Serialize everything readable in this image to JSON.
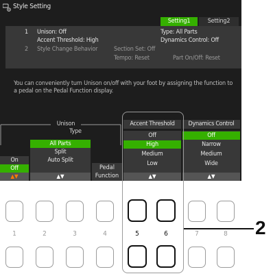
{
  "title": "Style Setting",
  "tabs": [
    "Setting1",
    "Setting2"
  ],
  "info": {
    "row1_num": "1",
    "unison": "Unison: Off",
    "type": "Type: All Parts",
    "accent": "Accent Threshold: High",
    "dynamics": "Dynamics Control: Off",
    "row2_num": "2",
    "scb": "Style Change Behavior",
    "section_set": "Section Set: Off",
    "tempo": "Tempo: Reset",
    "part_onoff": "Part On/Off: Reset"
  },
  "description": "You can conveniently turn Unison on/off with your foot by assigning the function to a pedal on the Pedal Function display.",
  "unison_group": {
    "label": "Unison",
    "type_label": "Type"
  },
  "columns": {
    "onoff": {
      "options": [
        "On",
        "Off"
      ],
      "selected": "Off",
      "arrows": "▲▼"
    },
    "type": {
      "options": [
        "All Parts",
        "Split",
        "Auto Split"
      ],
      "selected": "All Parts",
      "arrows": "▲▼"
    },
    "pedal": {
      "label": "Pedal Function"
    },
    "accent": {
      "header": "Accent Threshold",
      "options": [
        "Off",
        "High",
        "Medium",
        "Low"
      ],
      "selected": "High",
      "arrows": "▲▼"
    },
    "dynamics": {
      "header": "Dynamics Control",
      "options": [
        "Off",
        "Narrow",
        "Medium",
        "Wide"
      ],
      "selected": "Off",
      "arrows": "▲▼"
    }
  },
  "button_numbers": [
    "1",
    "2",
    "3",
    "4",
    "5",
    "6",
    "7",
    "8"
  ],
  "callout": "2",
  "colors": {
    "selected": "#35b000",
    "screen_bg": "#1d1d1d",
    "panel_bg": "#383838",
    "arrow_orange": "#ff7a00"
  }
}
